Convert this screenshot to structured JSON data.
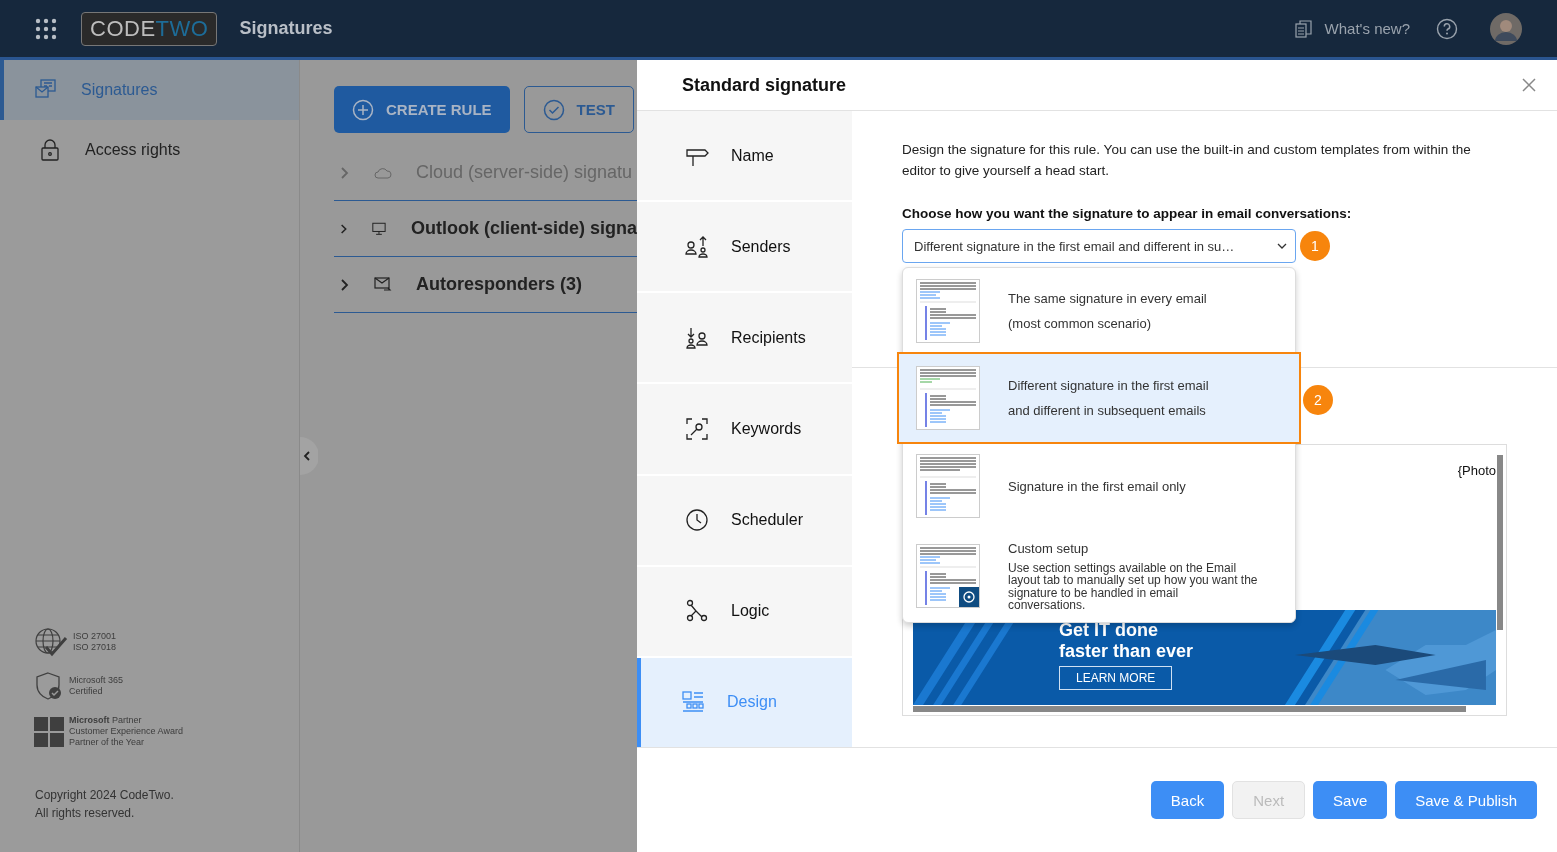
{
  "header": {
    "logo_left": "CODE",
    "logo_right": "TWO",
    "app_title": "Signatures",
    "whats_new": "What's new?"
  },
  "sidebar": {
    "items": [
      {
        "label": "Signatures",
        "selected": true
      },
      {
        "label": "Access rights",
        "selected": false
      }
    ],
    "badges": [
      {
        "lines": [
          "ISO 27001",
          "ISO 27018"
        ]
      },
      {
        "lines": [
          "Microsoft 365",
          "Certified"
        ]
      },
      {
        "lines": [
          "**Microsoft** Partner",
          "Customer Experience Award",
          "Partner of the Year"
        ]
      }
    ],
    "copyright": [
      "Copyright 2024 CodeTwo.",
      "All rights reserved."
    ]
  },
  "toolbar": {
    "create_rule": "CREATE RULE",
    "test": "TEST"
  },
  "rule_groups": [
    {
      "label": "Cloud (server-side) signatu",
      "disabled": true
    },
    {
      "label": "Outlook (client-side) signa",
      "disabled": false
    },
    {
      "label": "Autoresponders (3)",
      "disabled": false
    }
  ],
  "panel": {
    "title": "Standard signature",
    "steps": [
      {
        "label": "Name",
        "selected": false
      },
      {
        "label": "Senders",
        "selected": false
      },
      {
        "label": "Recipients",
        "selected": false
      },
      {
        "label": "Keywords",
        "selected": false
      },
      {
        "label": "Scheduler",
        "selected": false
      },
      {
        "label": "Logic",
        "selected": false
      },
      {
        "label": "Design",
        "selected": true
      }
    ],
    "description": "Design the signature for this rule. You can use the built-in and custom templates from within the editor to give yourself a head start.",
    "question": "Choose how you want the signature to appear in email conversations:",
    "select_value": "Different signature in the first email and different in su…",
    "select_callout": "1",
    "options": [
      {
        "kind": "same",
        "lines": [
          "The same signature in every email",
          "(most common scenario)"
        ],
        "selected": false
      },
      {
        "kind": "different",
        "lines": [
          "Different signature in the first email",
          "and different in subsequent emails"
        ],
        "selected": true,
        "callout": "2"
      },
      {
        "kind": "first_only",
        "lines": [
          "Signature in the first email only"
        ],
        "selected": false
      },
      {
        "kind": "custom",
        "title": "Custom setup",
        "note": "Use section settings available on the Email layout tab to manually set up how you want the signature to be handled in email conversations.",
        "selected": false
      }
    ],
    "preview": {
      "placeholder": "{Photo",
      "banner_title": [
        "Get IT done",
        "faster than ever"
      ],
      "banner_button": "LEARN MORE"
    },
    "buttons": [
      {
        "label": "Back",
        "disabled": false
      },
      {
        "label": "Next",
        "disabled": true
      },
      {
        "label": "Save",
        "disabled": false
      },
      {
        "label": "Save & Publish",
        "disabled": false
      }
    ]
  }
}
